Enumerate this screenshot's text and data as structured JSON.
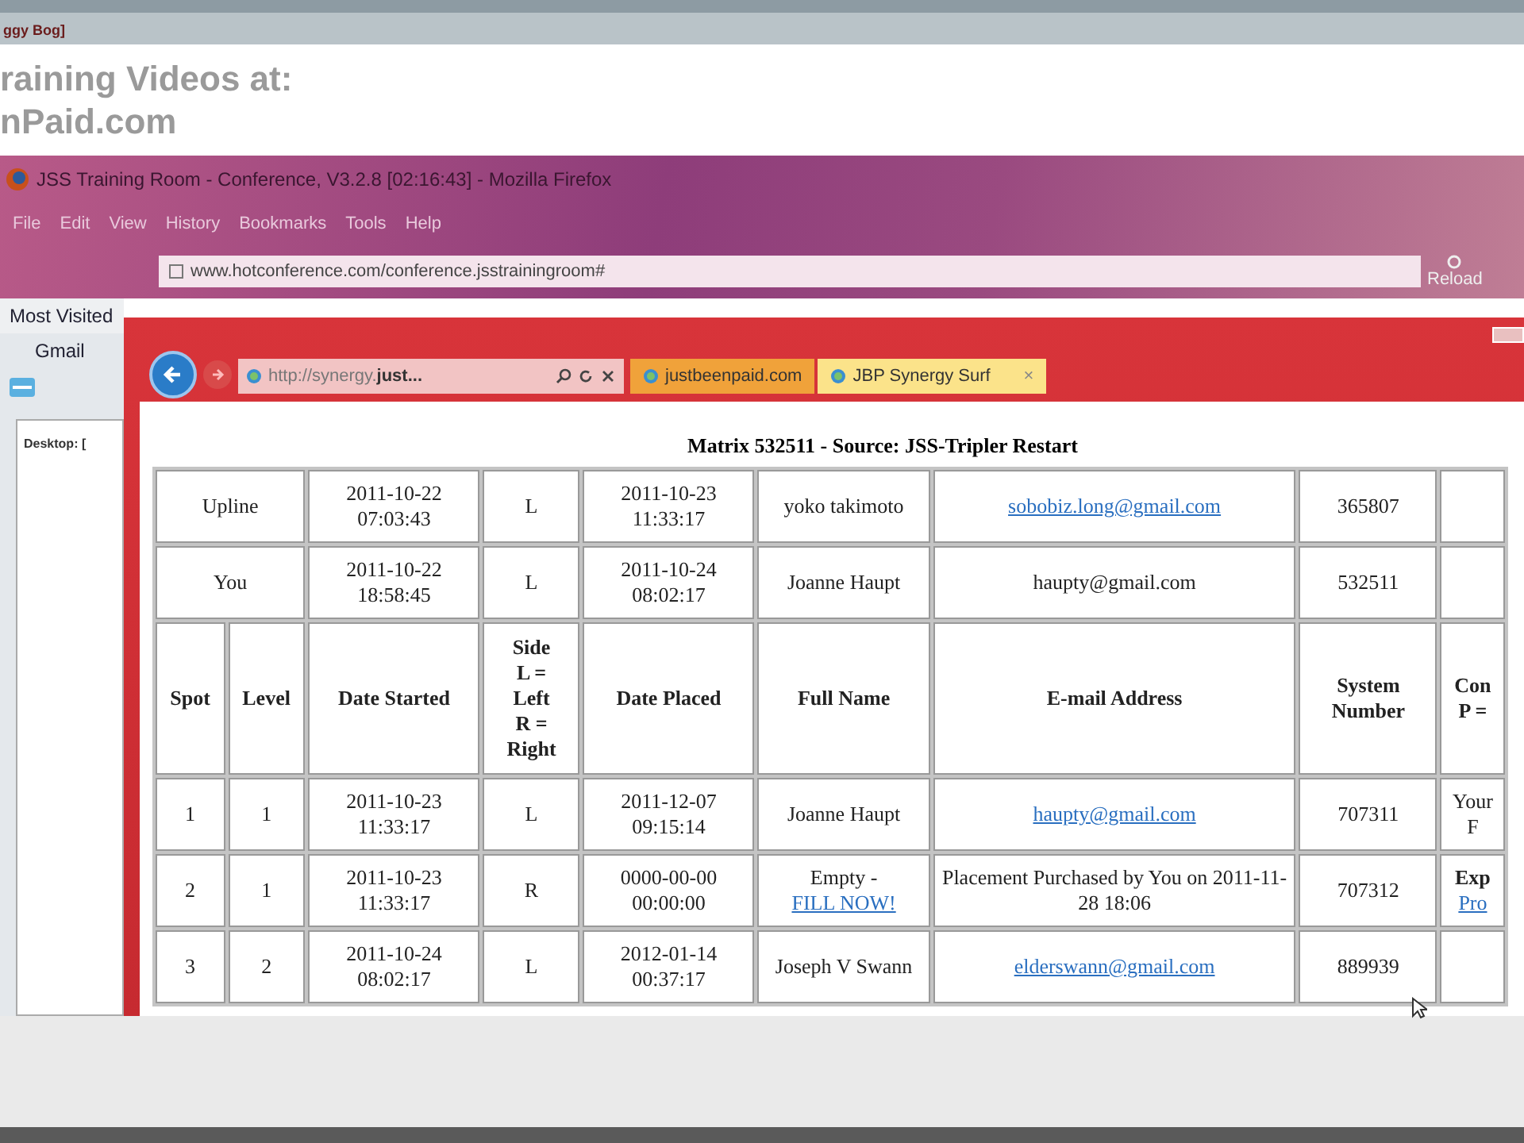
{
  "top_bar": {
    "title": "ggy Bog]"
  },
  "banner": {
    "lines": [
      "raining Videos at:",
      "nPaid.com"
    ]
  },
  "firefox": {
    "title": "JSS Training Room - Conference, V3.2.8 [02:16:43] - Mozilla Firefox",
    "menu": [
      "File",
      "Edit",
      "View",
      "History",
      "Bookmarks",
      "Tools",
      "Help"
    ],
    "url": "www.hotconference.com/conference.jsstrainingroom#",
    "reload": "Reload",
    "bookmarks": [
      "Most Visited"
    ],
    "side_items": [
      "Gmail"
    ],
    "panel_label": "Desktop: ["
  },
  "ie": {
    "address": "http://synergy.**just...**",
    "tabs": [
      {
        "label": "justbeenpaid.com",
        "selected": false
      },
      {
        "label": "JBP Synergy Surf",
        "selected": true,
        "close": "×"
      }
    ]
  },
  "page": {
    "title": "Matrix 532511 - Source: JSS-Tripler Restart",
    "summary_rows": [
      {
        "label": "Upline",
        "cells": [
          {
            "text": "2011-10-22 07:03:43"
          },
          {
            "text": "L"
          },
          {
            "text": "2011-10-23 11:33:17"
          },
          {
            "text": "yoko takimoto"
          },
          {
            "link": "sobobiz.long@gmail.com"
          },
          {
            "text": "365807"
          }
        ]
      },
      {
        "label": "You",
        "cells": [
          {
            "text": "2011-10-22 18:58:45"
          },
          {
            "text": "L"
          },
          {
            "text": "2011-10-24 08:02:17"
          },
          {
            "text": "Joanne Haupt"
          },
          {
            "text": "haupty@gmail.com"
          },
          {
            "text": "532511"
          }
        ]
      }
    ],
    "columns": [
      "Spot",
      "Level",
      "Date Started",
      "Side\nL =\nLeft\nR =\nRight",
      "Date Placed",
      "Full Name",
      "E-mail Address",
      "System\nNumber",
      "Con\nP ="
    ],
    "rows": [
      [
        {
          "text": "1"
        },
        {
          "text": "1"
        },
        {
          "text": "2011-10-23 11:33:17"
        },
        {
          "text": "L"
        },
        {
          "text": "2011-12-07 09:15:14"
        },
        {
          "text": "Joanne Haupt"
        },
        {
          "link": "haupty@gmail.com"
        },
        {
          "text": "707311"
        },
        {
          "text": "Your\nF"
        }
      ],
      [
        {
          "text": "2"
        },
        {
          "text": "1"
        },
        {
          "text": "2011-10-23 11:33:17"
        },
        {
          "text": "R"
        },
        {
          "text": "0000-00-00 00:00:00"
        },
        {
          "text": "Empty - ",
          "link": "FILL NOW!"
        },
        {
          "text": "Placement Purchased by You on 2011-11-28 18:06"
        },
        {
          "text": "707312"
        },
        {
          "text": "**Exp**",
          "link": "Pro"
        }
      ],
      [
        {
          "text": "3"
        },
        {
          "text": "2"
        },
        {
          "text": "2011-10-24 08:02:17"
        },
        {
          "text": "L"
        },
        {
          "text": "2012-01-14 00:37:17"
        },
        {
          "text": "Joseph V Swann"
        },
        {
          "link": "elderswann@gmail.com"
        },
        {
          "text": "889939"
        },
        {}
      ]
    ]
  }
}
